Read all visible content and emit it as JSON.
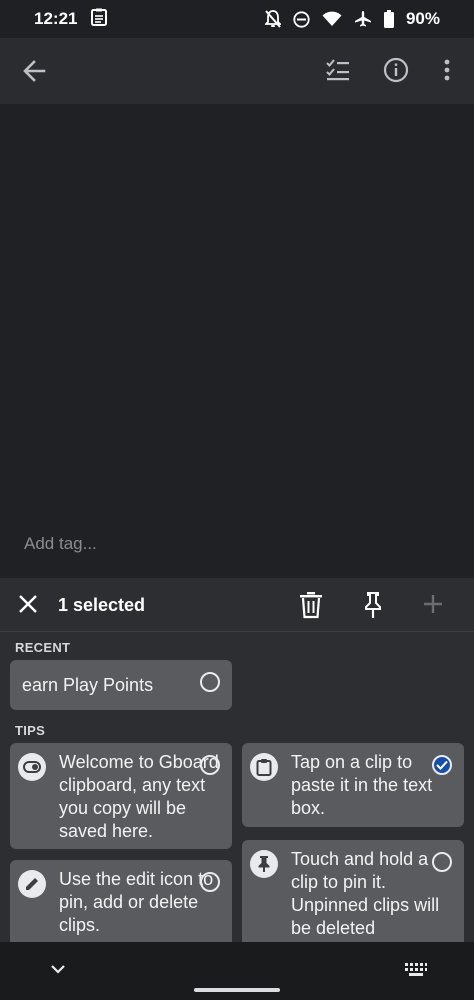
{
  "status_bar": {
    "time": "12:21",
    "battery": "90%",
    "icons": [
      "notepad-icon",
      "notifications-off-icon",
      "do-not-disturb-icon",
      "wifi-icon",
      "airplane-icon",
      "battery-icon"
    ]
  },
  "app_bar": {
    "icons": [
      "back-arrow-icon",
      "checklist-icon",
      "info-icon",
      "more-vert-icon"
    ]
  },
  "note": {
    "tag_placeholder": "Add tag..."
  },
  "clipboard": {
    "selected_label": "1 selected",
    "recent_label": "RECENT",
    "tips_label": "TIPS",
    "recent_items": [
      {
        "text": "earn Play Points",
        "selected": false
      }
    ],
    "tips": [
      {
        "icon": "toggle-icon",
        "text": "Welcome to Gboard clipboard, any text you copy will be saved here.",
        "selected": false
      },
      {
        "icon": "clipboard-icon",
        "text": "Tap on a clip to paste it in the text box.",
        "selected": true
      },
      {
        "icon": "edit-pencil-icon",
        "text": "Use the edit icon to pin, add or delete clips.",
        "selected": false
      },
      {
        "icon": "pin-icon",
        "text": "Touch and hold a clip to pin it. Unpinned clips will be deleted",
        "selected": false
      }
    ]
  },
  "colors": {
    "background": "#202124",
    "app_bar": "#2a2c2f",
    "panel": "#2d2e31",
    "clip": "#5a5b5e",
    "selected_check": "#174ea6"
  }
}
